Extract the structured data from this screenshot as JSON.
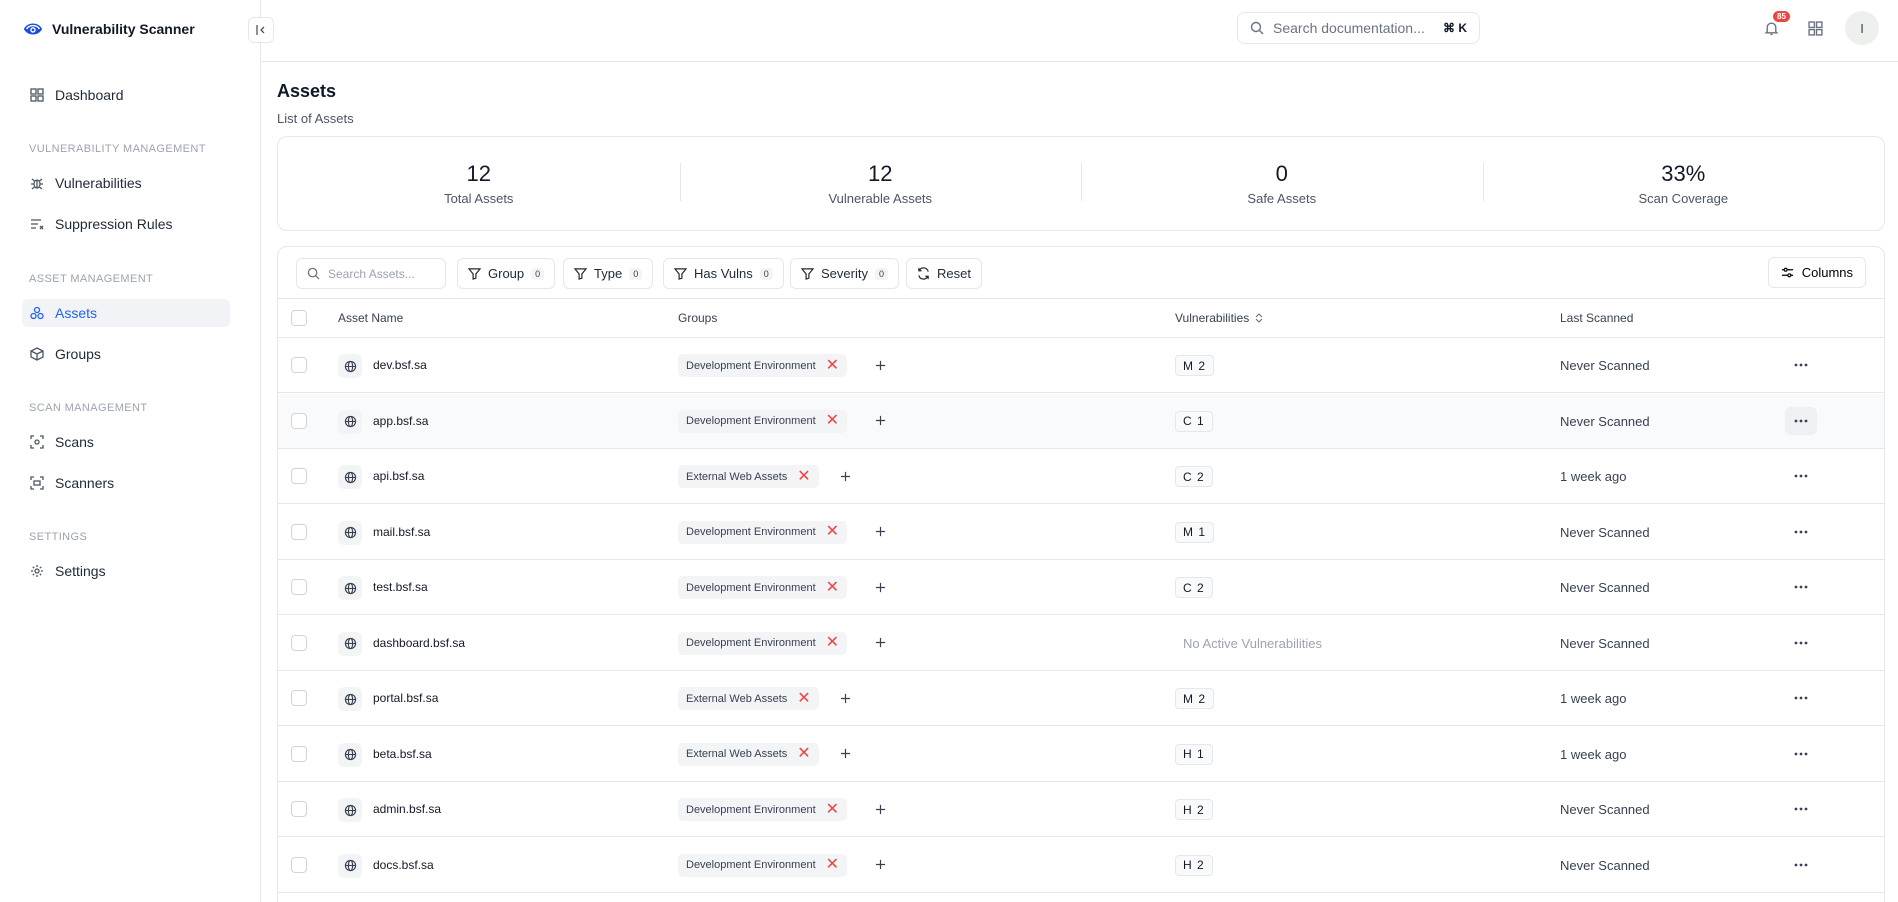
{
  "app": {
    "title": "Vulnerability Scanner"
  },
  "sidebar": {
    "dashboard": "Dashboard",
    "sections": [
      {
        "title": "Vulnerability Management",
        "items": [
          "Vulnerabilities",
          "Suppression Rules"
        ]
      },
      {
        "title": "Asset Management",
        "items": [
          "Assets",
          "Groups"
        ]
      },
      {
        "title": "Scan Management",
        "items": [
          "Scans",
          "Scanners"
        ]
      },
      {
        "title": "Settings",
        "items": [
          "Settings"
        ]
      }
    ],
    "active": "Assets"
  },
  "topbar": {
    "search_placeholder": "Search documentation...",
    "shortcut": "⌘ K",
    "notification_count": "85",
    "avatar_initial": "I"
  },
  "page": {
    "title": "Assets",
    "subtitle": "List of Assets"
  },
  "stats": [
    {
      "value": "12",
      "label": "Total Assets"
    },
    {
      "value": "12",
      "label": "Vulnerable Assets"
    },
    {
      "value": "0",
      "label": "Safe Assets"
    },
    {
      "value": "33%",
      "label": "Scan Coverage"
    }
  ],
  "toolbar": {
    "search_placeholder": "Search Assets...",
    "filters": [
      {
        "label": "Group",
        "count": "0"
      },
      {
        "label": "Type",
        "count": "0"
      },
      {
        "label": "Has Vulns",
        "count": "0"
      },
      {
        "label": "Severity",
        "count": "0"
      }
    ],
    "reset": "Reset",
    "columns": "Columns"
  },
  "table": {
    "headers": {
      "name": "Asset Name",
      "groups": "Groups",
      "vulns": "Vulnerabilities",
      "last": "Last Scanned"
    },
    "rows": [
      {
        "name": "dev.bsf.sa",
        "group": "Development Environment",
        "vuln": "M 2",
        "last": "Never Scanned"
      },
      {
        "name": "app.bsf.sa",
        "group": "Development Environment",
        "vuln": "C 1",
        "last": "Never Scanned"
      },
      {
        "name": "api.bsf.sa",
        "group": "External Web Assets",
        "vuln": "C 2",
        "last": "1 week ago"
      },
      {
        "name": "mail.bsf.sa",
        "group": "Development Environment",
        "vuln": "M 1",
        "last": "Never Scanned"
      },
      {
        "name": "test.bsf.sa",
        "group": "Development Environment",
        "vuln": "C 2",
        "last": "Never Scanned"
      },
      {
        "name": "dashboard.bsf.sa",
        "group": "Development Environment",
        "vuln": "",
        "vuln_none": "No Active Vulnerabilities",
        "last": "Never Scanned"
      },
      {
        "name": "portal.bsf.sa",
        "group": "External Web Assets",
        "vuln": "M 2",
        "last": "1 week ago"
      },
      {
        "name": "beta.bsf.sa",
        "group": "External Web Assets",
        "vuln": "H 1",
        "last": "1 week ago"
      },
      {
        "name": "admin.bsf.sa",
        "group": "Development Environment",
        "vuln": "H 2",
        "last": "Never Scanned"
      },
      {
        "name": "docs.bsf.sa",
        "group": "Development Environment",
        "vuln": "H 2",
        "last": "Never Scanned"
      }
    ]
  },
  "colors": {
    "accent": "#2563eb",
    "danger": "#ef4444"
  }
}
